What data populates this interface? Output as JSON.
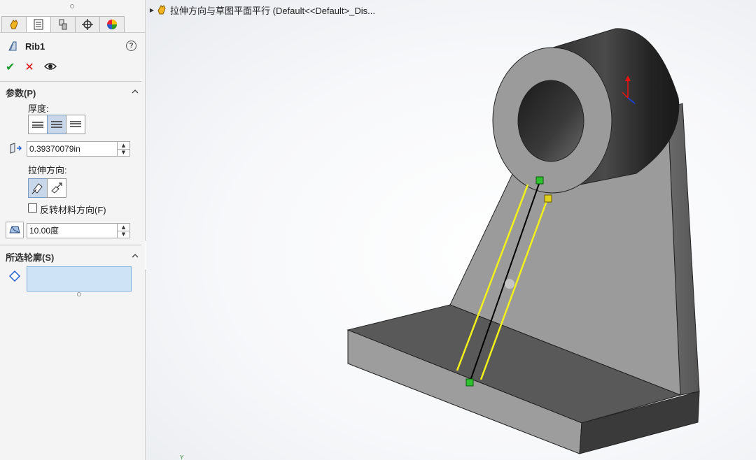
{
  "panel": {
    "tabs": [
      {
        "icon": "feature-manager-icon",
        "active": true
      },
      {
        "icon": "property-manager-icon",
        "active": false
      },
      {
        "icon": "configuration-manager-icon",
        "active": false
      },
      {
        "icon": "dimxpert-icon",
        "active": false
      },
      {
        "icon": "display-manager-icon",
        "active": false
      }
    ],
    "feature_name": "Rib1",
    "help_glyph": "?",
    "actions": {
      "ok_glyph": "✔",
      "cancel_glyph": "✕",
      "preview_icon": "eye-icon"
    },
    "params": {
      "title": "参数(P)",
      "thickness_label": "厚度:",
      "thickness_value": "0.39370079in",
      "direction_label": "拉伸方向:",
      "flip_label": "反转材料方向(F)",
      "flip_checked": false,
      "draft_value": "10.00度"
    },
    "contours": {
      "title": "所选轮廓(S)"
    }
  },
  "viewport": {
    "tree_text": "拉伸方向与草图平面平行  (Default<<Default>_Dis...",
    "axis_label": "Y"
  },
  "colors": {
    "accent": "#7fb2e3",
    "selection_fill": "#cfe3f7",
    "preview_line": "#f2f21a",
    "ok": "#1a9a2a",
    "cancel": "#dd1111"
  }
}
